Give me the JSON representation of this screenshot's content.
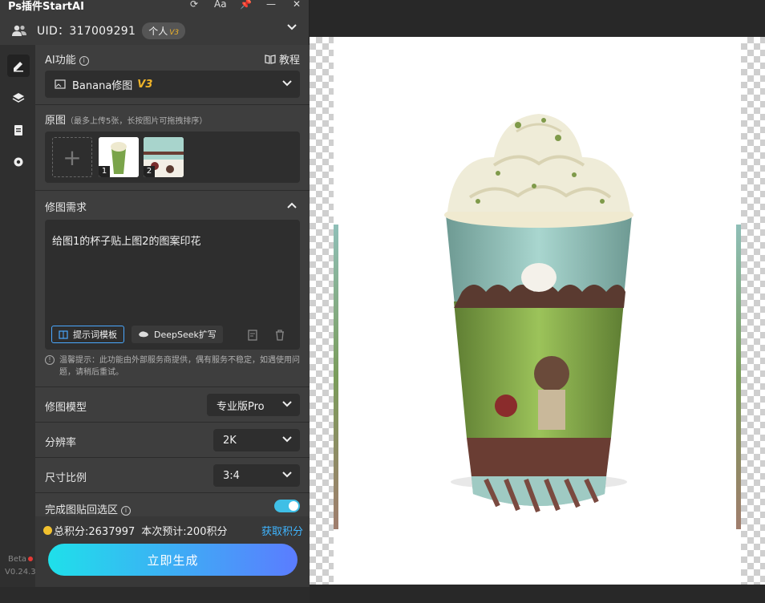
{
  "app": {
    "title": "Ps插件StartAI"
  },
  "titlebar": {
    "icons": [
      "refresh-icon",
      "font-size-icon",
      "pin-icon",
      "minimize-icon",
      "close-icon"
    ],
    "font_label": "Aa"
  },
  "user": {
    "uid_label": "UID：317009291",
    "plan": "个人",
    "plan_version": "V3"
  },
  "sidebar": {
    "items": [
      "edit-icon",
      "layers-icon",
      "clipboard-icon",
      "settings-icon"
    ],
    "beta": "Beta",
    "version": "V0.24.3"
  },
  "ai": {
    "label": "AI功能",
    "tutorial": "教程",
    "selected": "Banana修图",
    "selected_version": "V3"
  },
  "original": {
    "label": "原图",
    "hint": "（最多上传5张，长按图片可拖拽排序）",
    "add": "+",
    "thumbs": [
      {
        "num": "1"
      },
      {
        "num": "2"
      }
    ]
  },
  "requirement": {
    "label": "修图需求",
    "prompt": "给图1的杯子贴上图2的图案印花",
    "template_btn": "提示词模板",
    "deepseek_btn": "DeepSeek扩写"
  },
  "notice": "温馨提示：此功能由外部服务商提供，偶有服务不稳定，如遇使用问题，请稍后重试。",
  "settings": {
    "model_label": "修图模型",
    "model_value": "专业版Pro",
    "resolution_label": "分辨率",
    "resolution_value": "2K",
    "ratio_label": "尺寸比例",
    "ratio_value": "3:4",
    "paste_label": "完成图贴回选区",
    "paste_enabled": true
  },
  "footer": {
    "points": "总积分:2637997",
    "estimate": "本次预计:200积分",
    "get_points": "获取积分",
    "generate": "立即生成"
  },
  "colors": {
    "accent": "#3fb5ff",
    "brand_gradient_start": "#1fe0ea",
    "brand_gradient_end": "#5b7cff",
    "version_badge": "#f0b429"
  }
}
